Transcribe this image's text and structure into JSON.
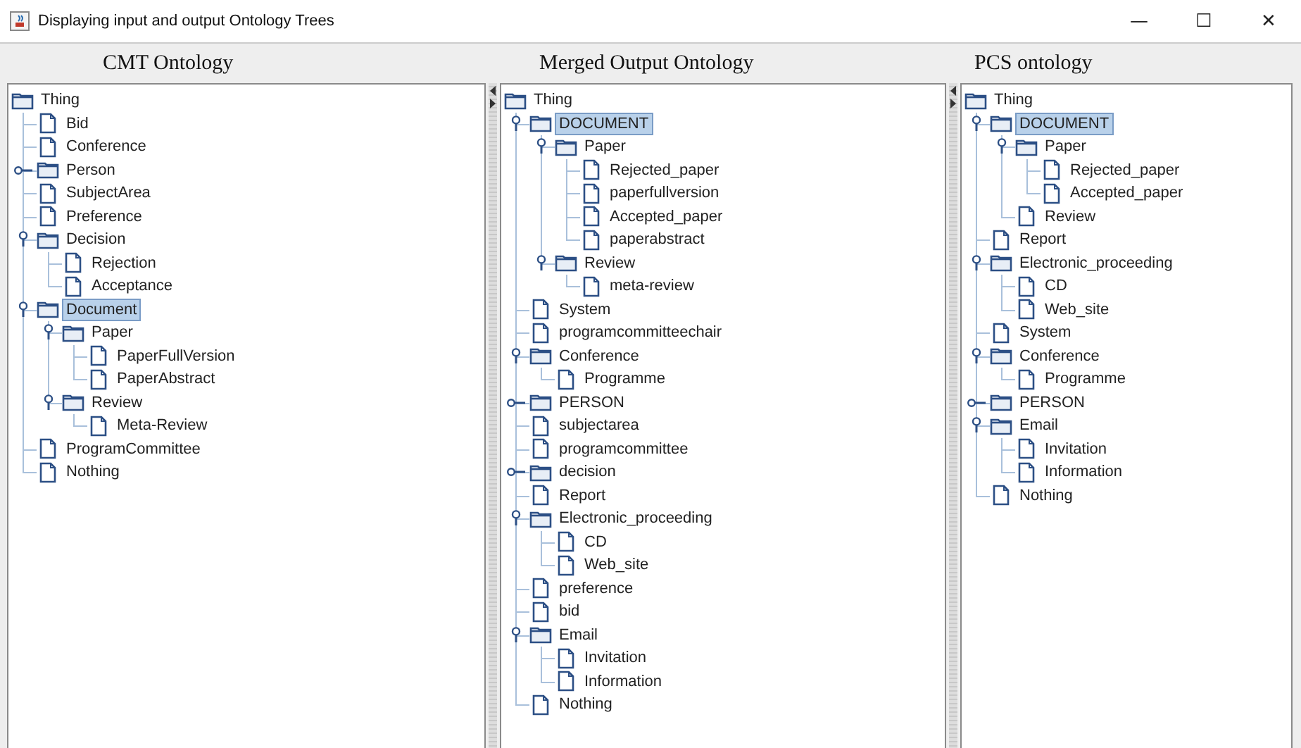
{
  "window": {
    "title": "Displaying input and output Ontology Trees",
    "controls": [
      "—",
      "☐",
      "✕"
    ]
  },
  "panels": [
    {
      "heading": "CMT Ontology",
      "tree": {
        "label": "Thing",
        "kind": "folder",
        "selected": false,
        "children": [
          {
            "label": "Bid",
            "kind": "leaf",
            "selected": false
          },
          {
            "label": "Conference",
            "kind": "leaf",
            "selected": false
          },
          {
            "label": "Person",
            "kind": "folder",
            "expanded": false,
            "selected": false
          },
          {
            "label": "SubjectArea",
            "kind": "leaf",
            "selected": false
          },
          {
            "label": "Preference",
            "kind": "leaf",
            "selected": false
          },
          {
            "label": "Decision",
            "kind": "folder",
            "expanded": true,
            "selected": false,
            "children": [
              {
                "label": "Rejection",
                "kind": "leaf",
                "selected": false
              },
              {
                "label": "Acceptance",
                "kind": "leaf",
                "selected": false
              }
            ]
          },
          {
            "label": "Document",
            "kind": "folder",
            "expanded": true,
            "selected": true,
            "children": [
              {
                "label": "Paper",
                "kind": "folder",
                "expanded": true,
                "selected": false,
                "children": [
                  {
                    "label": "PaperFullVersion",
                    "kind": "leaf",
                    "selected": false
                  },
                  {
                    "label": "PaperAbstract",
                    "kind": "leaf",
                    "selected": false
                  }
                ]
              },
              {
                "label": "Review",
                "kind": "folder",
                "expanded": true,
                "selected": false,
                "children": [
                  {
                    "label": "Meta-Review",
                    "kind": "leaf",
                    "selected": false
                  }
                ]
              }
            ]
          },
          {
            "label": "ProgramCommittee",
            "kind": "leaf",
            "selected": false
          },
          {
            "label": "Nothing",
            "kind": "leaf",
            "selected": false
          }
        ]
      }
    },
    {
      "heading": "Merged Output Ontology",
      "tree": {
        "label": "Thing",
        "kind": "folder",
        "selected": false,
        "children": [
          {
            "label": "DOCUMENT",
            "kind": "folder",
            "expanded": true,
            "selected": true,
            "children": [
              {
                "label": "Paper",
                "kind": "folder",
                "expanded": true,
                "selected": false,
                "children": [
                  {
                    "label": "Rejected_paper",
                    "kind": "leaf",
                    "selected": false
                  },
                  {
                    "label": "paperfullversion",
                    "kind": "leaf",
                    "selected": false
                  },
                  {
                    "label": "Accepted_paper",
                    "kind": "leaf",
                    "selected": false
                  },
                  {
                    "label": "paperabstract",
                    "kind": "leaf",
                    "selected": false
                  }
                ]
              },
              {
                "label": "Review",
                "kind": "folder",
                "expanded": true,
                "selected": false,
                "children": [
                  {
                    "label": "meta-review",
                    "kind": "leaf",
                    "selected": false
                  }
                ]
              }
            ]
          },
          {
            "label": "System",
            "kind": "leaf",
            "selected": false
          },
          {
            "label": "programcommitteechair",
            "kind": "leaf",
            "selected": false
          },
          {
            "label": "Conference",
            "kind": "folder",
            "expanded": true,
            "selected": false,
            "children": [
              {
                "label": "Programme",
                "kind": "leaf",
                "selected": false
              }
            ]
          },
          {
            "label": "PERSON",
            "kind": "folder",
            "expanded": false,
            "selected": false
          },
          {
            "label": "subjectarea",
            "kind": "leaf",
            "selected": false
          },
          {
            "label": "programcommittee",
            "kind": "leaf",
            "selected": false
          },
          {
            "label": "decision",
            "kind": "folder",
            "expanded": false,
            "selected": false
          },
          {
            "label": "Report",
            "kind": "leaf",
            "selected": false
          },
          {
            "label": "Electronic_proceeding",
            "kind": "folder",
            "expanded": true,
            "selected": false,
            "children": [
              {
                "label": "CD",
                "kind": "leaf",
                "selected": false
              },
              {
                "label": "Web_site",
                "kind": "leaf",
                "selected": false
              }
            ]
          },
          {
            "label": "preference",
            "kind": "leaf",
            "selected": false
          },
          {
            "label": "bid",
            "kind": "leaf",
            "selected": false
          },
          {
            "label": "Email",
            "kind": "folder",
            "expanded": true,
            "selected": false,
            "children": [
              {
                "label": "Invitation",
                "kind": "leaf",
                "selected": false
              },
              {
                "label": "Information",
                "kind": "leaf",
                "selected": false
              }
            ]
          },
          {
            "label": "Nothing",
            "kind": "leaf",
            "selected": false
          }
        ]
      }
    },
    {
      "heading": "PCS ontology",
      "tree": {
        "label": "Thing",
        "kind": "folder",
        "selected": false,
        "children": [
          {
            "label": "DOCUMENT",
            "kind": "folder",
            "expanded": true,
            "selected": true,
            "children": [
              {
                "label": "Paper",
                "kind": "folder",
                "expanded": true,
                "selected": false,
                "children": [
                  {
                    "label": "Rejected_paper",
                    "kind": "leaf",
                    "selected": false
                  },
                  {
                    "label": "Accepted_paper",
                    "kind": "leaf",
                    "selected": false
                  }
                ]
              },
              {
                "label": "Review",
                "kind": "leaf",
                "selected": false
              }
            ]
          },
          {
            "label": "Report",
            "kind": "leaf",
            "selected": false
          },
          {
            "label": "Electronic_proceeding",
            "kind": "folder",
            "expanded": true,
            "selected": false,
            "children": [
              {
                "label": "CD",
                "kind": "leaf",
                "selected": false
              },
              {
                "label": "Web_site",
                "kind": "leaf",
                "selected": false
              }
            ]
          },
          {
            "label": "System",
            "kind": "leaf",
            "selected": false
          },
          {
            "label": "Conference",
            "kind": "folder",
            "expanded": true,
            "selected": false,
            "children": [
              {
                "label": "Programme",
                "kind": "leaf",
                "selected": false
              }
            ]
          },
          {
            "label": "PERSON",
            "kind": "folder",
            "expanded": false,
            "selected": false
          },
          {
            "label": "Email",
            "kind": "folder",
            "expanded": true,
            "selected": false,
            "children": [
              {
                "label": "Invitation",
                "kind": "leaf",
                "selected": false
              },
              {
                "label": "Information",
                "kind": "leaf",
                "selected": false
              }
            ]
          },
          {
            "label": "Nothing",
            "kind": "leaf",
            "selected": false
          }
        ]
      }
    }
  ]
}
